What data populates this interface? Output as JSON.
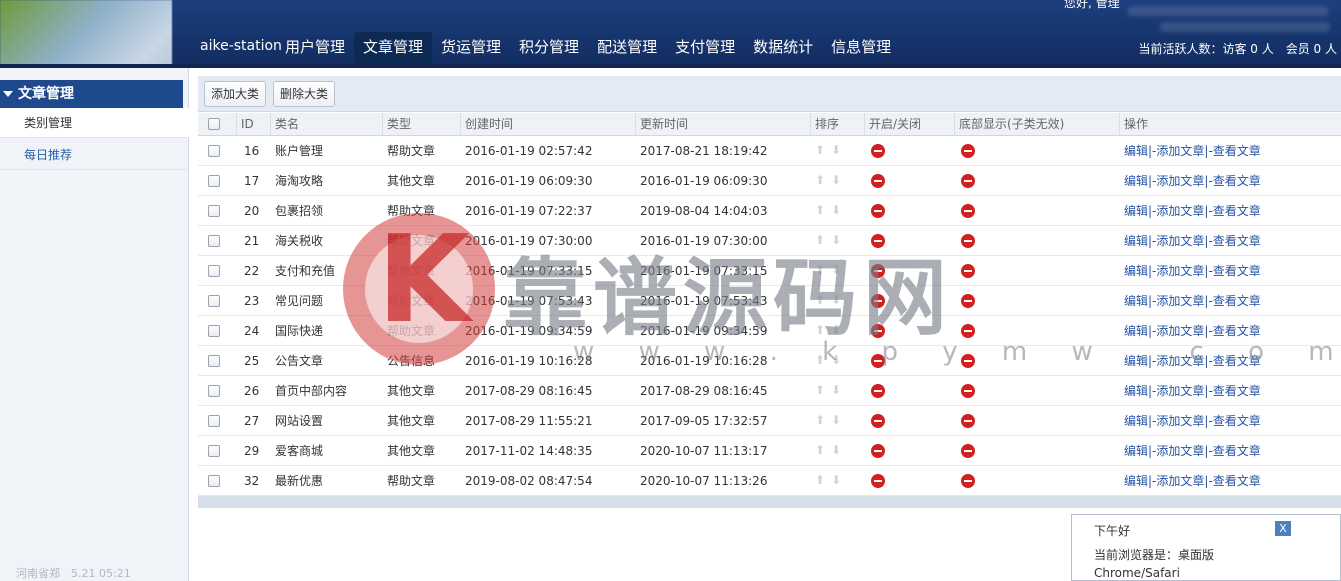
{
  "header": {
    "brand": "aike-station",
    "nav": [
      "用户管理",
      "文章管理",
      "货运管理",
      "积分管理",
      "配送管理",
      "支付管理",
      "数据统计",
      "信息管理"
    ],
    "active_nav": "文章管理",
    "user_greeting": "您好, 管理",
    "online_stats": "当前活跃人数：访客 0 人　会员 0 人"
  },
  "sidebar": {
    "title": "文章管理",
    "items": [
      "类别管理",
      "每日推荐"
    ],
    "active_item": "类别管理",
    "footer": "河南省郑　5.21 05:21"
  },
  "toolbar": {
    "add_label": "添加大类",
    "delete_label": "删除大类"
  },
  "table": {
    "columns": [
      "ID",
      "类名",
      "类型",
      "创建时间",
      "更新时间",
      "排序",
      "开启/关闭",
      "底部显示(子类无效)",
      "操作"
    ],
    "ops": [
      "编辑",
      "|-",
      "添加文章",
      "|-",
      "查看文章"
    ],
    "rows": [
      {
        "id": "16",
        "name": "账户管理",
        "type": "帮助文章",
        "created": "2016-01-19 02:57:42",
        "updated": "2017-08-21 18:19:42"
      },
      {
        "id": "17",
        "name": "海淘攻略",
        "type": "其他文章",
        "created": "2016-01-19 06:09:30",
        "updated": "2016-01-19 06:09:30"
      },
      {
        "id": "20",
        "name": "包裹招领",
        "type": "帮助文章",
        "created": "2016-01-19 07:22:37",
        "updated": "2019-08-04 14:04:03"
      },
      {
        "id": "21",
        "name": "海关税收",
        "type": "帮助文章",
        "created": "2016-01-19 07:30:00",
        "updated": "2016-01-19 07:30:00"
      },
      {
        "id": "22",
        "name": "支付和充值",
        "type": "帮助文章",
        "created": "2016-01-19 07:33:15",
        "updated": "2016-01-19 07:33:15"
      },
      {
        "id": "23",
        "name": "常见问题",
        "type": "帮助文章",
        "created": "2016-01-19 07:53:43",
        "updated": "2016-01-19 07:53:43"
      },
      {
        "id": "24",
        "name": "国际快递",
        "type": "帮助文章",
        "created": "2016-01-19 09:34:59",
        "updated": "2016-01-19 09:34:59"
      },
      {
        "id": "25",
        "name": "公告文章",
        "type": "公告信息",
        "created": "2016-01-19 10:16:28",
        "updated": "2016-01-19 10:16:28"
      },
      {
        "id": "26",
        "name": "首页中部内容",
        "type": "其他文章",
        "created": "2017-08-29 08:16:45",
        "updated": "2017-08-29 08:16:45"
      },
      {
        "id": "27",
        "name": "网站设置",
        "type": "其他文章",
        "created": "2017-08-29 11:55:21",
        "updated": "2017-09-05 17:32:57"
      },
      {
        "id": "29",
        "name": "爱客商城",
        "type": "其他文章",
        "created": "2017-11-02 14:48:35",
        "updated": "2020-10-07 11:13:17"
      },
      {
        "id": "32",
        "name": "最新优惠",
        "type": "帮助文章",
        "created": "2019-08-02 08:47:54",
        "updated": "2020-10-07 11:13:26"
      }
    ]
  },
  "watermark": {
    "logo_letter": "K",
    "text": "靠谱源码网",
    "url": "w w w . k p y m w . c o m"
  },
  "popup": {
    "greeting": "下午好",
    "close": "X",
    "line1": "当前浏览器是：桌面版",
    "line2": "Chrome/Safari"
  },
  "colors": {
    "header_bg": "#1a3a76",
    "sidebar_title_bg": "#1e4a8d",
    "link": "#2553a6",
    "stop_icon": "#d21f1f"
  }
}
